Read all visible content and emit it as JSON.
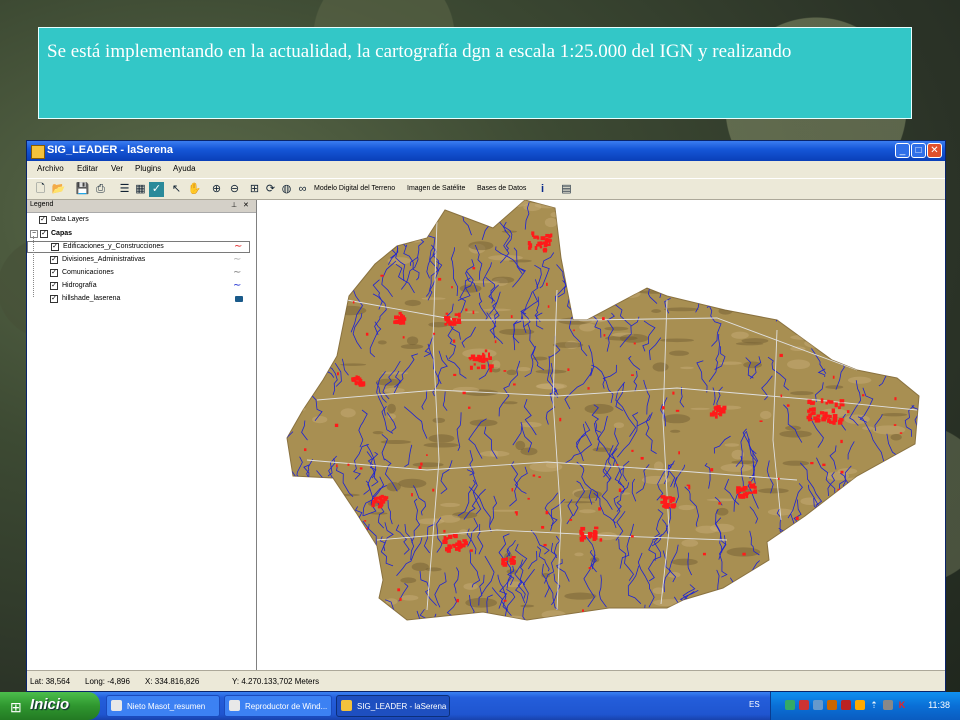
{
  "banner": {
    "text": "Se está implementando en la actualidad, la cartografía dgn a escala 1:25.000  del IGN  y realizando"
  },
  "window": {
    "title": "SIG_LEADER  - laSerena",
    "buttons": {
      "minimize": "_",
      "maximize": "□",
      "close": "✕"
    }
  },
  "menu": {
    "items": [
      "Archivo",
      "Editar",
      "Ver",
      "Plugins",
      "Ayuda"
    ]
  },
  "toolbar": {
    "layer_labels": [
      "Modelo Digital del Terreno",
      "Imagen de Satélite",
      "Bases de Datos"
    ],
    "icons": [
      "new-file-icon",
      "open-folder-icon",
      "save-icon",
      "print-icon",
      "properties-icon",
      "zoom-full-icon",
      "select-arrow-icon",
      "pan-hand-icon",
      "zoom-in-icon",
      "zoom-out-icon",
      "zoom-window-icon",
      "refresh-icon",
      "globe-icon",
      "binoculars-icon",
      "info-icon",
      "table-icon"
    ]
  },
  "legend": {
    "title": "Legend",
    "pin": "⊥",
    "close": "✕",
    "root": "Data Layers",
    "group": "Capas",
    "layers": [
      {
        "name": "Edificaciones_y_Construcciones",
        "symbol_color": "#e02020"
      },
      {
        "name": "Divisiones_Administrativas",
        "symbol_color": "#b0b0b0"
      },
      {
        "name": "Comunicaciones",
        "symbol_color": "#808080"
      },
      {
        "name": "Hidrografía",
        "symbol_color": "#1a2ad0"
      },
      {
        "name": "hillshade_laserena",
        "symbol_color": "#1a5a8a"
      }
    ]
  },
  "map": {
    "fill_color": "#a88f52",
    "river_color": "#1c22d6",
    "building_color": "#ff1a1a",
    "admin_line_color": "#e0e0e0"
  },
  "status": {
    "lat": "Lat: 38,564",
    "long": "Long: -4,896",
    "x": "X: 334.816,826",
    "y": "Y: 4.270.133,702 Meters"
  },
  "taskbar": {
    "start": "Inicio",
    "tasks": [
      "Nieto Masot_resumen",
      "Reproductor de Wind...",
      "SIG_LEADER - laSerena"
    ],
    "lang": "ES",
    "clock": "11:38"
  }
}
